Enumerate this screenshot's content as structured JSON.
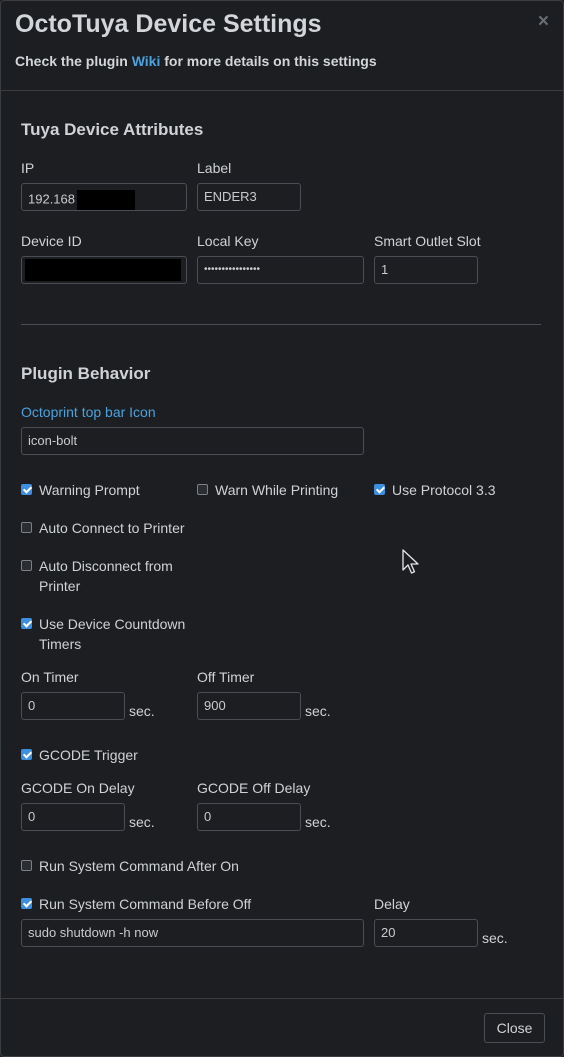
{
  "header": {
    "title": "OctoTuya Device Settings",
    "close_glyph": "×",
    "subtitle_before": "Check the plugin ",
    "subtitle_link": "Wiki",
    "subtitle_after": " for more details on this settings"
  },
  "device": {
    "section_title": "Tuya Device Attributes",
    "ip_label": "IP",
    "ip_value": "192.168",
    "label_label": "Label",
    "label_value": "ENDER3",
    "device_id_label": "Device ID",
    "local_key_label": "Local Key",
    "local_key_value": "••••••••••••••••",
    "slot_label": "Smart Outlet Slot",
    "slot_value": "1"
  },
  "behavior": {
    "section_title": "Plugin Behavior",
    "icon_label": "Octoprint top bar Icon",
    "icon_value": "icon-bolt",
    "warning_prompt": {
      "label": "Warning Prompt",
      "checked": true
    },
    "warn_printing": {
      "label": "Warn While Printing",
      "checked": false
    },
    "protocol": {
      "label": "Use Protocol 3.3",
      "checked": true
    },
    "auto_connect": {
      "label": "Auto Connect to Printer",
      "checked": false
    },
    "auto_disconnect": {
      "label": "Auto Disconnect from Printer",
      "checked": false
    },
    "countdown": {
      "label": "Use Device Countdown Timers",
      "checked": true
    },
    "on_timer_label": "On Timer",
    "on_timer_value": "0",
    "off_timer_label": "Off Timer",
    "off_timer_value": "900",
    "unit": "sec.",
    "gcode": {
      "label": "GCODE Trigger",
      "checked": true
    },
    "gcode_on_label": "GCODE On Delay",
    "gcode_on_value": "0",
    "gcode_off_label": "GCODE Off Delay",
    "gcode_off_value": "0",
    "cmd_after_on": {
      "label": "Run System Command After On",
      "checked": false
    },
    "cmd_before_off": {
      "label": "Run System Command Before Off",
      "checked": true
    },
    "cmd_value": "sudo shutdown -h now",
    "delay_label": "Delay",
    "delay_value": "20"
  },
  "footer": {
    "close_label": "Close"
  }
}
